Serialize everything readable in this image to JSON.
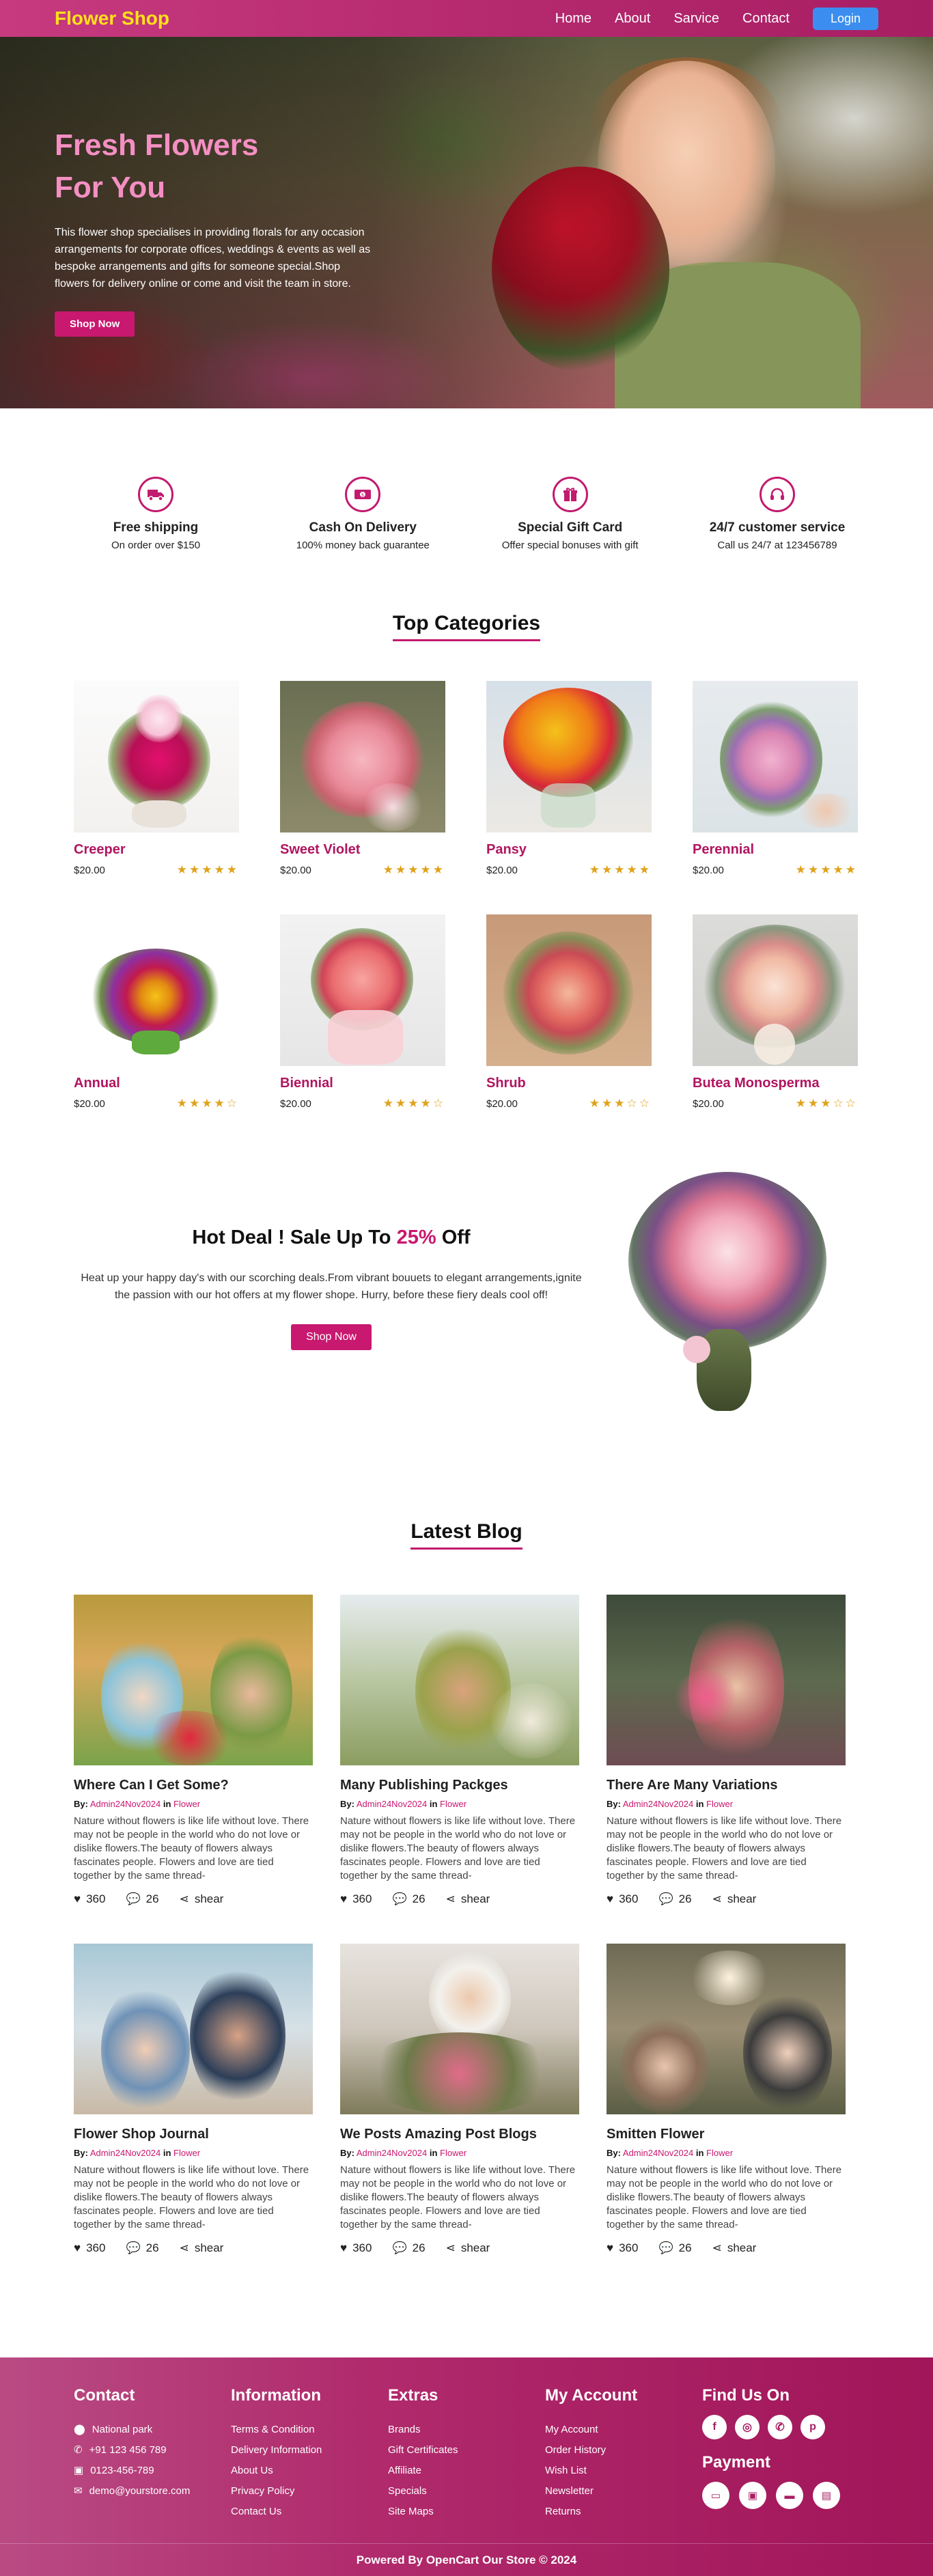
{
  "header": {
    "logo": "Flower Shop",
    "nav": [
      "Home",
      "About",
      "Sarvice",
      "Contact"
    ],
    "login": "Login"
  },
  "hero": {
    "title_line1": "Fresh Flowers",
    "title_line2": "For You",
    "description": "This flower shop specialises in providing florals for any occasion arrangements for corporate offices, weddings & events as well as bespoke arrangements and gifts for someone special.Shop flowers for delivery online or come and visit the team in store.",
    "button": "Shop Now"
  },
  "features": [
    {
      "icon": "truck-icon",
      "title": "Free shipping",
      "subtitle": "On order over $150"
    },
    {
      "icon": "cash-icon",
      "title": "Cash On Delivery",
      "subtitle": "100% money back guarantee"
    },
    {
      "icon": "gift-icon",
      "title": "Special Gift Card",
      "subtitle": "Offer special bonuses with gift"
    },
    {
      "icon": "headset-icon",
      "title": "24/7 customer service",
      "subtitle": "Call us 24/7 at 123456789"
    }
  ],
  "categories": {
    "title": "Top Categories",
    "items": [
      {
        "name": "Creeper",
        "price": "$20.00",
        "rating": 5
      },
      {
        "name": "Sweet Violet",
        "price": "$20.00",
        "rating": 5
      },
      {
        "name": "Pansy",
        "price": "$20.00",
        "rating": 5
      },
      {
        "name": "Perennial",
        "price": "$20.00",
        "rating": 5
      },
      {
        "name": "Annual",
        "price": "$20.00",
        "rating": 4
      },
      {
        "name": "Biennial",
        "price": "$20.00",
        "rating": 4
      },
      {
        "name": "Shrub",
        "price": "$20.00",
        "rating": 3
      },
      {
        "name": "Butea Monosperma",
        "price": "$20.00",
        "rating": 3
      }
    ]
  },
  "deal": {
    "title_prefix": "Hot Deal ! Sale Up To ",
    "title_percent": "25%",
    "title_suffix": " Off",
    "description": "Heat up your happy day's with our scorching deals.From vibrant bouuets to elegant arrangements,ignite the passion with our hot offers at my flower shope. Hurry, before these fiery deals cool off!",
    "button": "Shop Now"
  },
  "blog": {
    "title": "Latest Blog",
    "by_label": "By:",
    "in_label": "in",
    "posts": [
      {
        "title": "Where Can I Get Some?",
        "author": "Admin24Nov2024",
        "category": "Flower",
        "body": "Nature without flowers is like life without love. There may not be people in the world who do not love or dislike flowers.The beauty of flowers always fascinates people. Flowers and love are tied together by the same thread-",
        "likes": "360",
        "comments": "26",
        "share": "shear"
      },
      {
        "title": "Many Publishing Packges",
        "author": "Admin24Nov2024",
        "category": "Flower",
        "body": "Nature without flowers is like life without love. There may not be people in the world who do not love or dislike flowers.The beauty of flowers always fascinates people. Flowers and love are tied together by the same thread-",
        "likes": "360",
        "comments": "26",
        "share": "shear"
      },
      {
        "title": "There Are Many Variations",
        "author": "Admin24Nov2024",
        "category": "Flower",
        "body": "Nature without flowers is like life without love. There may not be people in the world who do not love or dislike flowers.The beauty of flowers always fascinates people. Flowers and love are tied together by the same thread-",
        "likes": "360",
        "comments": "26",
        "share": "shear"
      },
      {
        "title": "Flower Shop Journal",
        "author": "Admin24Nov2024",
        "category": "Flower",
        "body": "Nature without flowers is like life without love. There may not be people in the world who do not love or dislike flowers.The beauty of flowers always fascinates people. Flowers and love are tied together by the same thread-",
        "likes": "360",
        "comments": "26",
        "share": "shear"
      },
      {
        "title": "We Posts Amazing Post Blogs",
        "author": "Admin24Nov2024",
        "category": "Flower",
        "body": "Nature without flowers is like life without love. There may not be people in the world who do not love or dislike flowers.The beauty of flowers always fascinates people. Flowers and love are tied together by the same thread-",
        "likes": "360",
        "comments": "26",
        "share": "shear"
      },
      {
        "title": "Smitten Flower",
        "author": "Admin24Nov2024",
        "category": "Flower",
        "body": "Nature without flowers is like life without love. There may not be people in the world who do not love or dislike flowers.The beauty of flowers always fascinates people. Flowers and love are tied together by the same thread-",
        "likes": "360",
        "comments": "26",
        "share": "shear"
      }
    ]
  },
  "footer": {
    "contact": {
      "title": "Contact",
      "items": [
        {
          "icon": "location-icon",
          "text": "National park"
        },
        {
          "icon": "phone-icon",
          "text": "+91 123 456 789"
        },
        {
          "icon": "fax-icon",
          "text": "0123-456-789"
        },
        {
          "icon": "mail-icon",
          "text": "demo@yourstore.com"
        }
      ]
    },
    "information": {
      "title": "Information",
      "items": [
        "Terms & Condition",
        "Delivery Information",
        "About Us",
        "Privacy Policy",
        "Contact Us"
      ]
    },
    "extras": {
      "title": "Extras",
      "items": [
        "Brands",
        "Gift Certificates",
        "Affiliate",
        "Specials",
        "Site Maps"
      ]
    },
    "account": {
      "title": "My Account",
      "items": [
        "My Account",
        "Order History",
        "Wish List",
        "Newsletter",
        "Returns"
      ]
    },
    "find_us": {
      "title": "Find Us On",
      "social": [
        "facebook-icon",
        "instagram-icon",
        "whatsapp-icon",
        "pinterest-icon"
      ]
    },
    "payment": {
      "title": "Payment",
      "methods": [
        "card-icon",
        "wallet-icon",
        "bank-card-icon",
        "credit-card-icon"
      ]
    },
    "copyright": "Powered By OpenCart Our Store © 2024"
  },
  "colors": {
    "brand": "#c8186f",
    "logo": "#ffe11a",
    "login": "#3b8eef",
    "star": "#e0a21a"
  }
}
